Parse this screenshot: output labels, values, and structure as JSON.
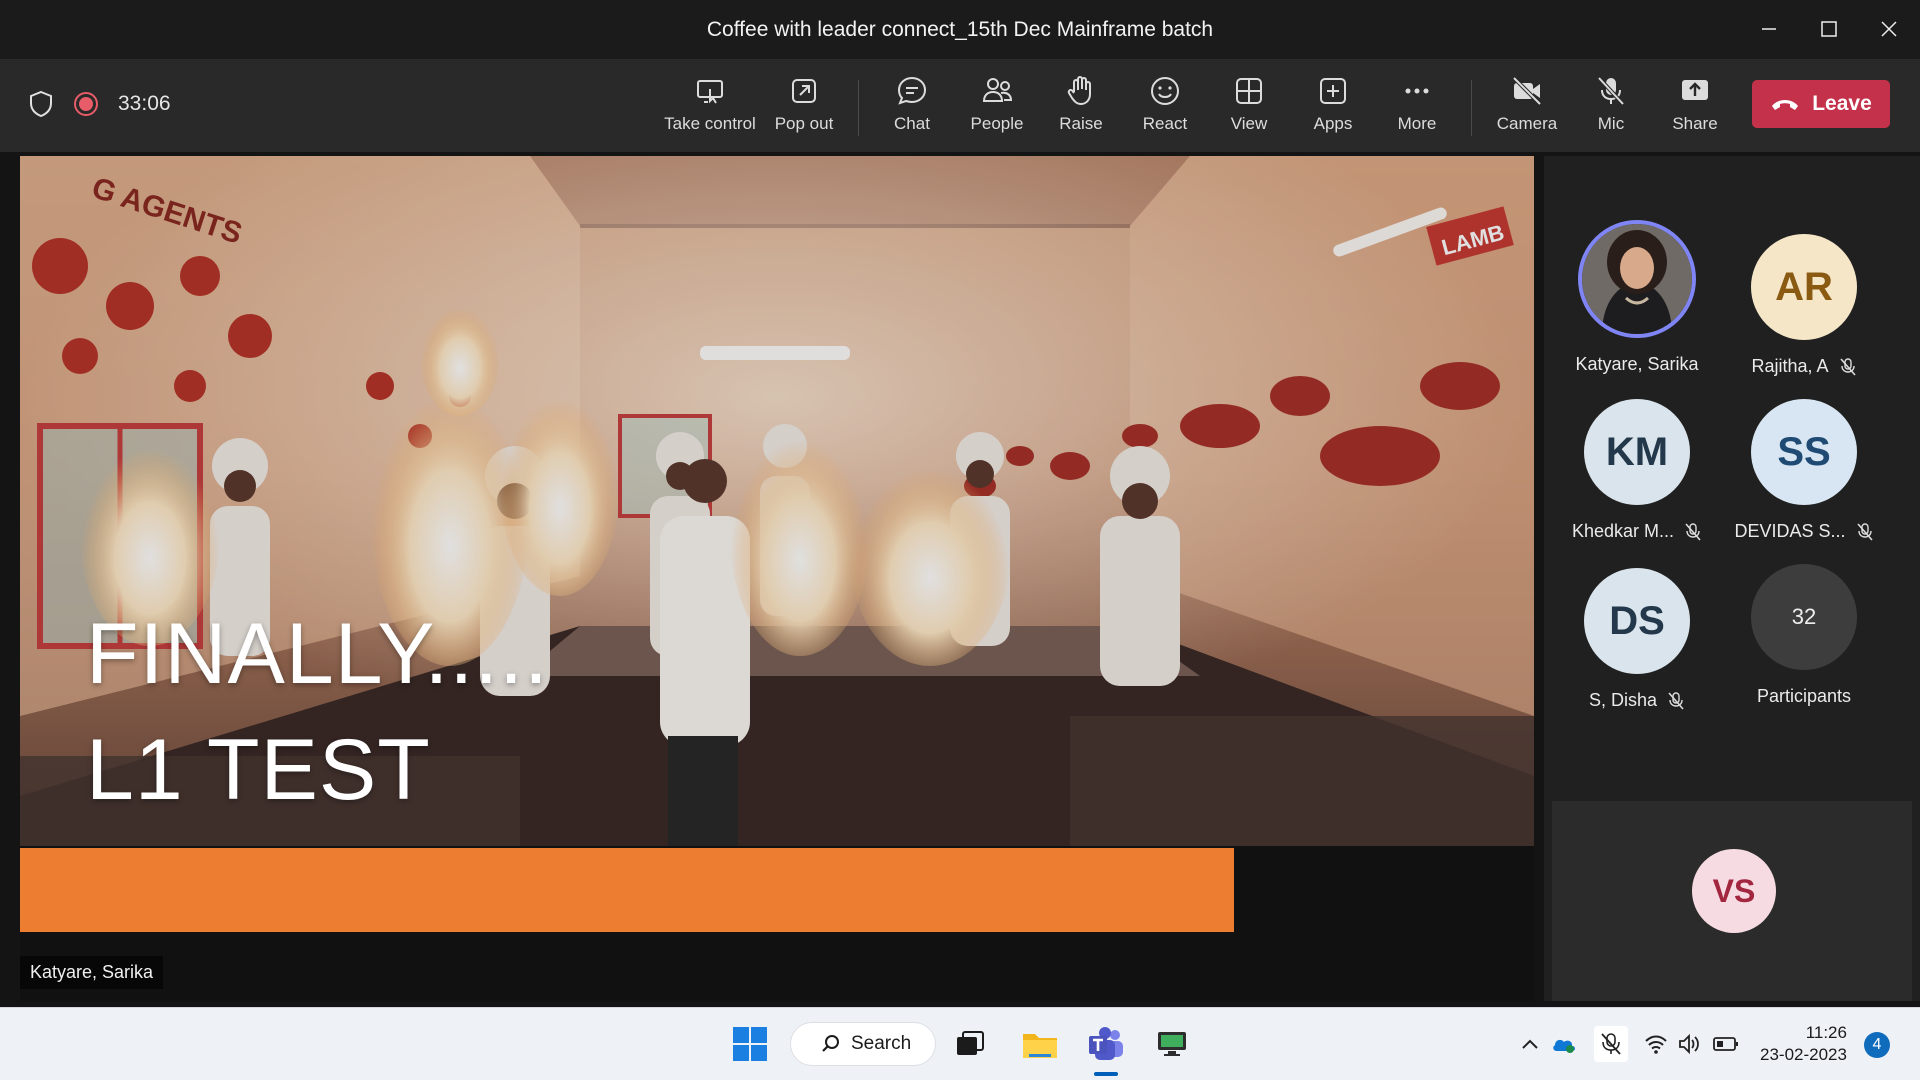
{
  "window": {
    "title": "Coffee with leader connect_15th Dec Mainframe batch",
    "controls": {
      "minimize": "—",
      "maximize": "☐",
      "close": "✕"
    }
  },
  "meeting": {
    "timer": "33:06",
    "recording": true
  },
  "toolbar": {
    "take_control": "Take control",
    "pop_out": "Pop out",
    "chat": "Chat",
    "people": "People",
    "raise": "Raise",
    "react": "React",
    "view": "View",
    "apps": "Apps",
    "more": "More",
    "camera": "Camera",
    "mic": "Mic",
    "share": "Share",
    "leave": "Leave"
  },
  "stage": {
    "slide_line1": "FINALLY.....",
    "slide_line2": "L1 TEST",
    "presenter": "Katyare, Sarika",
    "photo_signs": [
      "G AGENTS",
      "LAMB"
    ]
  },
  "participants": [
    {
      "name": "Katyare, Sarika",
      "initials": "",
      "muted": false,
      "avatar_bg": "#3a3a3a",
      "speaking": true
    },
    {
      "name": "Rajitha, A",
      "initials": "AR",
      "muted": true,
      "avatar_bg": "#f5e6c8",
      "fg": "#8a5a12"
    },
    {
      "name": "Khedkar M...",
      "initials": "KM",
      "muted": true,
      "avatar_bg": "#d9e4ec",
      "fg": "#23384a"
    },
    {
      "name": "DEVIDAS S...",
      "initials": "SS",
      "muted": true,
      "avatar_bg": "#d7e6f2",
      "fg": "#1e4a73"
    },
    {
      "name": "S, Disha",
      "initials": "DS",
      "muted": true,
      "avatar_bg": "#d9e4ec",
      "fg": "#23384a"
    }
  ],
  "overflow": {
    "count": "32",
    "label": "Participants"
  },
  "self_view": {
    "initials": "VS",
    "avatar_bg": "#f6dbe3",
    "fg": "#a3263f"
  },
  "taskbar": {
    "search_label": "Search",
    "time": "11:26",
    "date": "23-02-2023",
    "notifications": "4"
  },
  "colors": {
    "leave": "#c4314b",
    "accent_bar": "#ed7d31",
    "speaking_ring": "#7f85f5"
  }
}
